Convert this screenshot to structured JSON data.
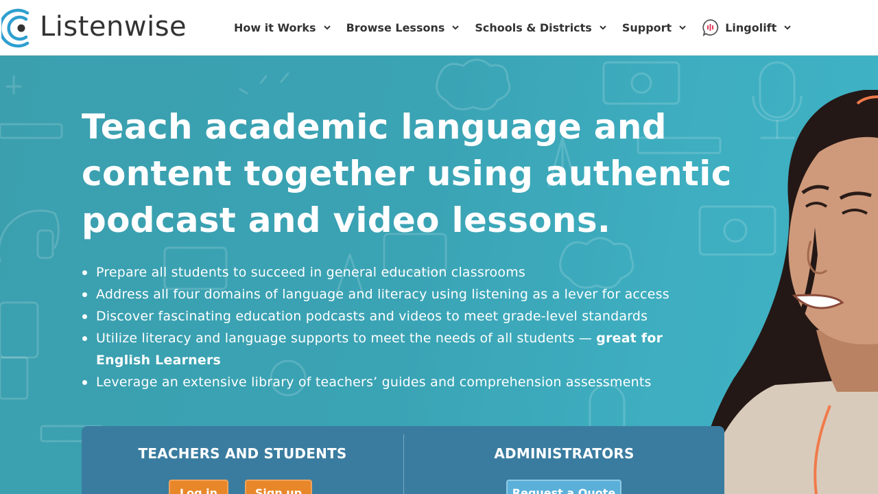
{
  "brand": {
    "name": "Listenwise",
    "colors": {
      "logo_blue": "#2e9fcf",
      "logo_text": "#333333",
      "hero_teal": "#3eaec0",
      "panel": "#3a7ca0",
      "orange": "#e8872a",
      "quote_blue": "#5ab0d8"
    }
  },
  "nav": {
    "items": [
      {
        "label": "How it Works",
        "icon": "chevron-down-icon"
      },
      {
        "label": "Browse Lessons",
        "icon": "chevron-down-icon"
      },
      {
        "label": "Schools & Districts",
        "icon": "chevron-down-icon"
      },
      {
        "label": "Support",
        "icon": "chevron-down-icon"
      },
      {
        "label": "Lingolift",
        "icon": "chevron-down-icon",
        "leading_icon": "lingolift-speech-icon"
      }
    ]
  },
  "hero": {
    "headline_lines": [
      "Teach academic language and",
      "content together using authentic",
      "podcast and video lessons."
    ],
    "bullets": [
      {
        "text": "Prepare all students to succeed in general education classrooms"
      },
      {
        "text": "Address all four domains of language and literacy using listening as a lever for access"
      },
      {
        "text": "Discover fascinating education podcasts and videos to meet grade-level standards"
      },
      {
        "text": "Utilize literacy and language supports to meet the needs of all students — ",
        "bold": "great for English Learners"
      },
      {
        "text": "Leverage an extensive library of teachers’ guides and comprehension assessments"
      }
    ]
  },
  "panel": {
    "teachers": {
      "title": "TEACHERS AND STUDENTS",
      "login_label": "Log in",
      "signup_label": "Sign up"
    },
    "admins": {
      "title": "ADMINISTRATORS",
      "quote_label": "Request a Quote"
    }
  }
}
